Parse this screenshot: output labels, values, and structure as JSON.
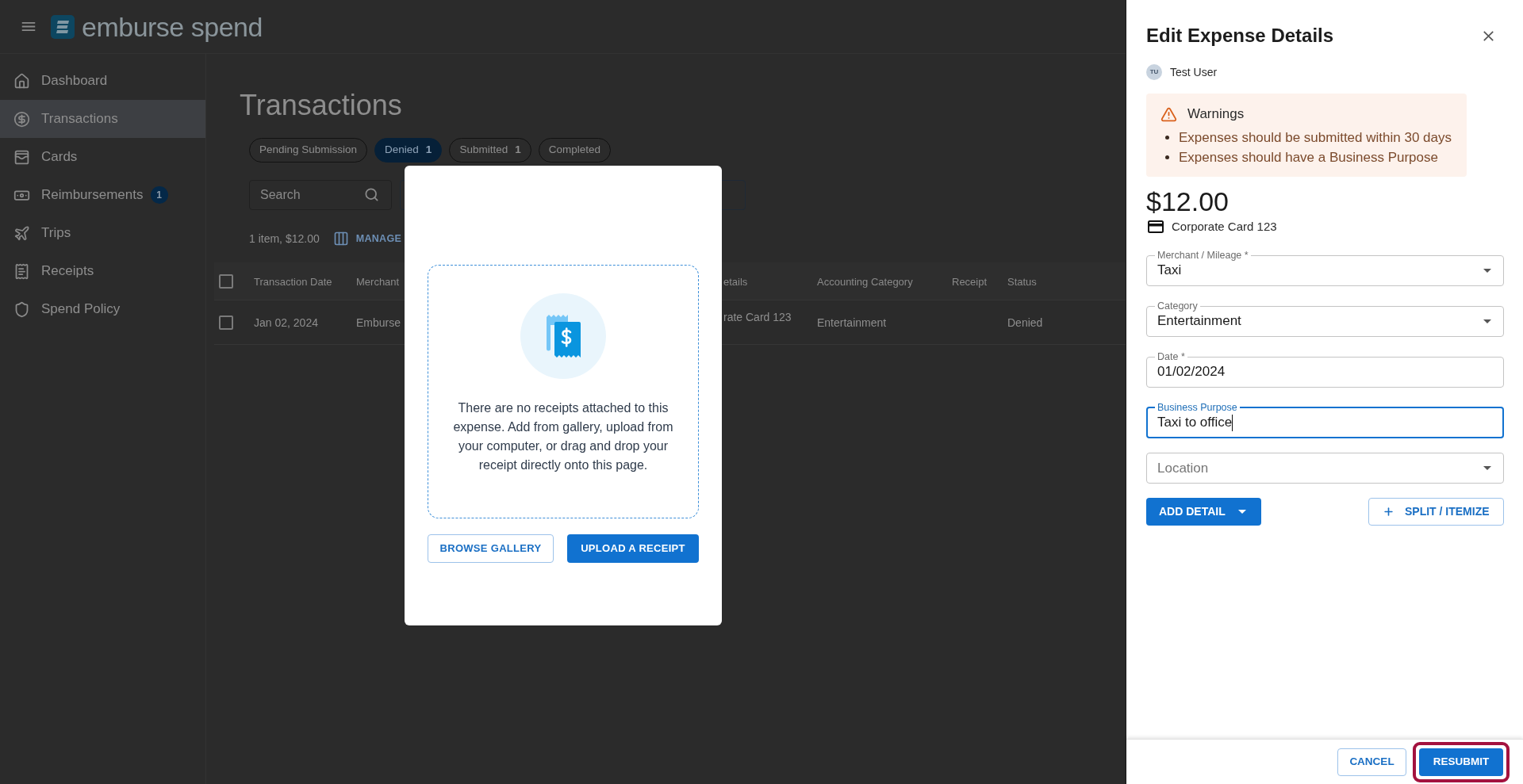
{
  "header": {
    "logo": "emburse spend"
  },
  "sidebar": {
    "items": [
      {
        "label": "Dashboard",
        "selected": false
      },
      {
        "label": "Transactions",
        "selected": true
      },
      {
        "label": "Cards",
        "selected": false
      },
      {
        "label": "Reimbursements",
        "selected": false,
        "badge": "1"
      },
      {
        "label": "Trips",
        "selected": false
      },
      {
        "label": "Receipts",
        "selected": false
      },
      {
        "label": "Spend Policy",
        "selected": false
      }
    ]
  },
  "page": {
    "title": "Transactions",
    "filters": [
      {
        "label": "Pending Submission",
        "selected": false
      },
      {
        "label": "Denied",
        "count": "1",
        "selected": true
      },
      {
        "label": "Submitted",
        "count": "1",
        "selected": false
      },
      {
        "label": "Completed",
        "selected": false
      }
    ],
    "search": {
      "placeholder": "Search"
    },
    "summary": "1 item, $12.00",
    "manage_link": "MANAGE",
    "table": {
      "select_all_checked": false,
      "columns": [
        "Transaction Date",
        "Merchant",
        "etails",
        "Accounting Category",
        "Receipt",
        "Status"
      ],
      "rows": [
        {
          "checked": false,
          "cells": [
            "Jan 02, 2024",
            "Emburse",
            "rate Card 123",
            "Entertainment",
            null,
            "Denied"
          ]
        }
      ]
    }
  },
  "receipt_dialog": {
    "message": "There are no receipts attached to this expense. Add from gallery, upload from your computer, or drag and drop your receipt directly onto this page.",
    "buttons": [
      {
        "label": "BROWSE GALLERY",
        "kind": "outlined"
      },
      {
        "label": "UPLOAD A RECEIPT",
        "kind": "filled"
      }
    ]
  },
  "expense_panel": {
    "title": "Edit Expense Details",
    "user": {
      "initials": "TU",
      "name": "Test User"
    },
    "warnings": {
      "title": "Warnings",
      "items": [
        "Expenses should be submitted within 30 days",
        "Expenses should have a Business Purpose"
      ]
    },
    "amount": "$12.00",
    "card": "Corporate Card 123",
    "fields": [
      {
        "kind": "select",
        "label": "Merchant / Mileage *",
        "value": "Taxi",
        "focused": false
      },
      {
        "kind": "select",
        "label": "Category",
        "value": "Entertainment",
        "focused": false
      },
      {
        "kind": "text",
        "label": "Date *",
        "value": "01/02/2024",
        "focused": false
      },
      {
        "kind": "text",
        "label": "Business Purpose",
        "value": "Taxi to office",
        "focused": true
      },
      {
        "kind": "select",
        "placeholder": "Location",
        "focused": false
      }
    ],
    "actions": [
      {
        "kind": "dropdown",
        "label": "ADD DETAIL"
      },
      {
        "kind": "add",
        "label": "SPLIT / ITEMIZE"
      }
    ],
    "footer": [
      {
        "kind": "outlined",
        "label": "CANCEL",
        "highlighted": false
      },
      {
        "kind": "filled",
        "label": "RESUBMIT",
        "highlighted": true
      }
    ]
  }
}
